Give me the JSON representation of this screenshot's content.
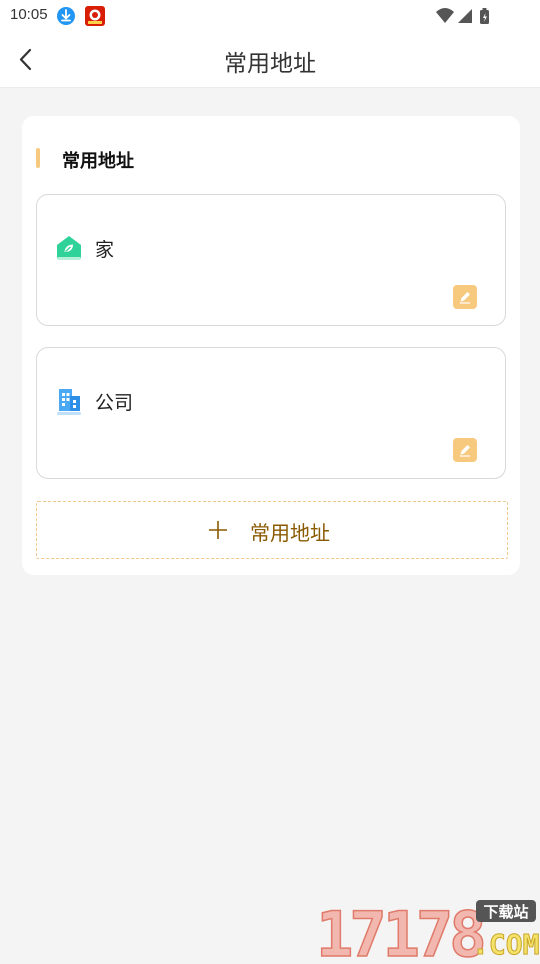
{
  "status_bar": {
    "time": "10:05",
    "icons": [
      "download-icon",
      "app-badge-icon",
      "wifi-icon",
      "signal-icon",
      "battery-icon"
    ]
  },
  "nav": {
    "back_icon": "chevron-left-icon",
    "title": "常用地址"
  },
  "section": {
    "title": "常用地址",
    "accent_color": "#f7c97f"
  },
  "addresses": [
    {
      "icon": "home-icon",
      "label": "家",
      "icon_color": "#2fd39a",
      "edit_icon": "pencil-icon"
    },
    {
      "icon": "office-building-icon",
      "label": "公司",
      "icon_color": "#4aa8f5",
      "edit_icon": "pencil-icon"
    }
  ],
  "add_button": {
    "icon": "plus-icon",
    "label": "常用地址",
    "color": "#8a5a00",
    "border_color": "#f0c88a"
  },
  "watermark": {
    "brand": "17178",
    "suffix": ".COM",
    "tag": "下载站"
  },
  "colors": {
    "page_background": "#f4f4f4",
    "card_background": "#ffffff"
  }
}
